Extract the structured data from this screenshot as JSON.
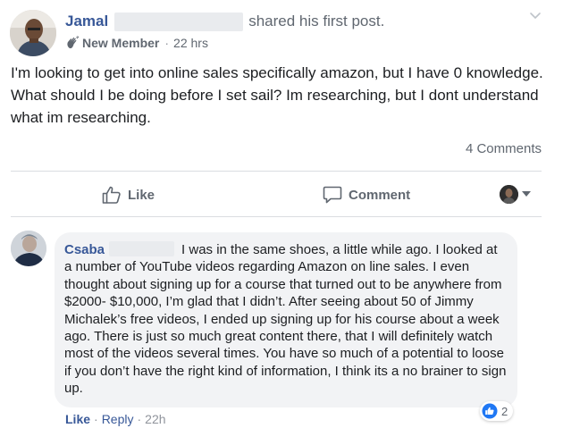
{
  "post": {
    "author": "Jamal",
    "shared_text": "shared his first post.",
    "badge": "New Member",
    "time": "22 hrs",
    "dot": "·",
    "body": "I'm looking to get into online sales specifically amazon, but I have 0 knowledge. What should I be doing before I set sail? Im researching, but I dont understand what im researching.",
    "comments_count": "4 Comments",
    "icons": {
      "options": "chevron-down-icon",
      "badge": "wave-hand-icon"
    }
  },
  "actions": {
    "like_label": "Like",
    "comment_label": "Comment",
    "icons": {
      "like": "thumbs-up-icon",
      "comment": "comment-icon",
      "audience": "caret-down-icon"
    }
  },
  "comment": {
    "author": "Csaba",
    "text": "I was in the same shoes, a little while ago. I looked at a number of YouTube videos regarding Amazon on line sales. I even thought about signing up for a course that turned out to be anywhere from $2000- $10,000, I’m glad that I didn’t. After seeing about 50 of Jimmy Michalek’s free videos, I ended up signing up for his course about a week ago. There is just so much great content there, that I will definitely watch most of the videos several times. You have so much of a potential to loose if you don’t have the right kind of information, I think its a no brainer to sign up.",
    "like_label": "Like",
    "reply_label": "Reply",
    "separator": "·",
    "time": "22h",
    "reaction_count": "2",
    "icons": {
      "reaction": "like-reaction-icon"
    }
  },
  "colors": {
    "link": "#385898",
    "secondary_text": "#606770",
    "divider": "#dadde1",
    "bubble": "#f2f3f5",
    "like_blue": "#2078f4"
  }
}
